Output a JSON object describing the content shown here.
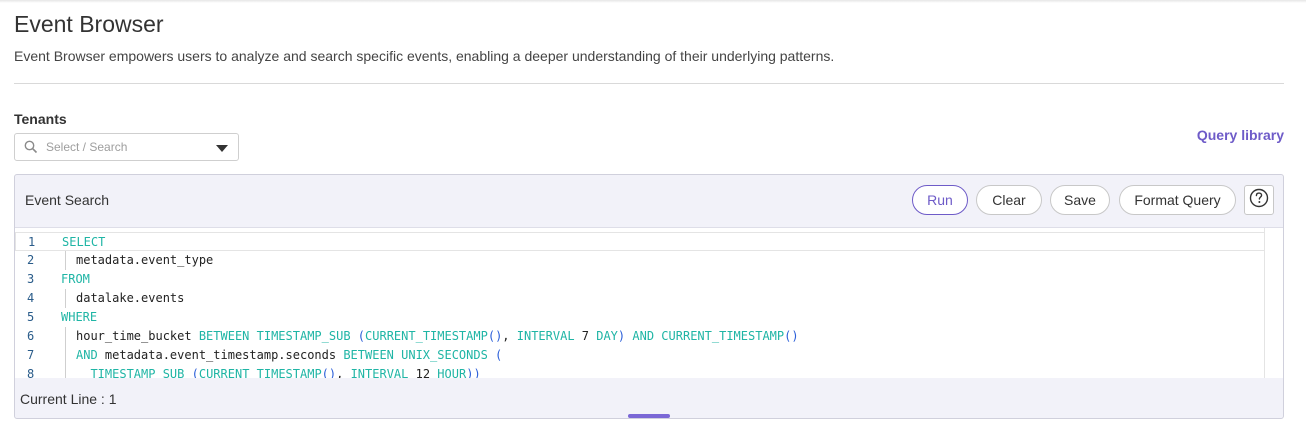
{
  "page": {
    "title": "Event Browser",
    "description": "Event Browser empowers users to analyze and search specific events, enabling a deeper understanding of their underlying patterns."
  },
  "tenants": {
    "label": "Tenants",
    "placeholder": "Select / Search"
  },
  "query_library": {
    "label": "Query library"
  },
  "event_search": {
    "title": "Event Search",
    "buttons": {
      "run": "Run",
      "clear": "Clear",
      "save": "Save",
      "format": "Format Query"
    },
    "help_icon": "question-circle-icon"
  },
  "editor": {
    "lines": [
      {
        "n": "1",
        "tokens": [
          [
            "kw",
            "SELECT"
          ]
        ]
      },
      {
        "n": "2",
        "indent": true,
        "tokens": [
          [
            "ident",
            "metadata.event_type"
          ]
        ]
      },
      {
        "n": "3",
        "tokens": [
          [
            "kw",
            "FROM"
          ]
        ]
      },
      {
        "n": "4",
        "indent": true,
        "tokens": [
          [
            "ident",
            "datalake.events"
          ]
        ]
      },
      {
        "n": "5",
        "tokens": [
          [
            "kw",
            "WHERE"
          ]
        ]
      },
      {
        "n": "6",
        "indent": true,
        "tokens": [
          [
            "ident",
            "hour_time_bucket "
          ],
          [
            "kw",
            "BETWEEN "
          ],
          [
            "fn",
            "TIMESTAMP_SUB "
          ],
          [
            "paren",
            "("
          ],
          [
            "fn",
            "CURRENT_TIMESTAMP"
          ],
          [
            "paren",
            "()"
          ],
          [
            "ident",
            ", "
          ],
          [
            "kw",
            "INTERVAL "
          ],
          [
            "num",
            "7 "
          ],
          [
            "kw",
            "DAY"
          ],
          [
            "paren",
            ")"
          ],
          [
            "ident",
            " "
          ],
          [
            "kw",
            "AND "
          ],
          [
            "fn",
            "CURRENT_TIMESTAMP"
          ],
          [
            "paren",
            "()"
          ]
        ]
      },
      {
        "n": "7",
        "indent": true,
        "tokens": [
          [
            "kw",
            "AND "
          ],
          [
            "ident",
            "metadata.event_timestamp.seconds "
          ],
          [
            "kw",
            "BETWEEN "
          ],
          [
            "fn",
            "UNIX_SECONDS "
          ],
          [
            "paren",
            "("
          ]
        ]
      },
      {
        "n": "8",
        "indent": true,
        "tokens": [
          [
            "ident",
            "  "
          ],
          [
            "fn",
            "TIMESTAMP_SUB "
          ],
          [
            "paren",
            "("
          ],
          [
            "fn",
            "CURRENT_TIMESTAMP"
          ],
          [
            "paren",
            "()"
          ],
          [
            "ident",
            ", "
          ],
          [
            "kw",
            "INTERVAL "
          ],
          [
            "num",
            "12 "
          ],
          [
            "kw",
            "HOUR"
          ],
          [
            "paren",
            ")"
          ],
          [
            "paren",
            ")"
          ]
        ]
      }
    ]
  },
  "status": {
    "current_line": "Current Line : 1"
  },
  "colors": {
    "accent": "#6e5bc8",
    "keyword": "#1fb5a5",
    "paren": "#2b5fd9",
    "line_number": "#2a5c8a"
  }
}
